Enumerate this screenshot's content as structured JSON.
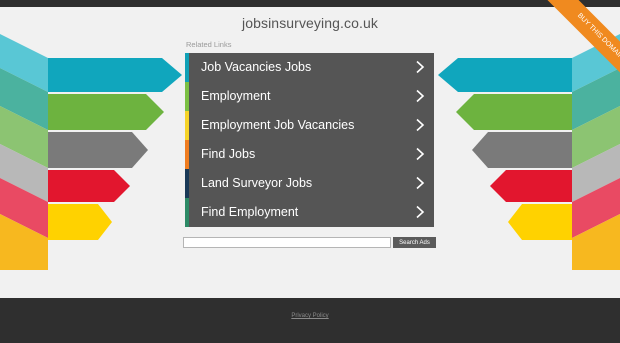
{
  "header": {
    "domain": "jobsinsurveying.co.uk"
  },
  "ribbon": {
    "label": "BUY THIS DOMAIN"
  },
  "related": {
    "label": "Related Links",
    "links": [
      {
        "label": "Job Vacancies Jobs",
        "accent": "#10a0b6"
      },
      {
        "label": "Employment",
        "accent": "#7bc043"
      },
      {
        "label": "Employment Job Vacancies",
        "accent": "#f5d328"
      },
      {
        "label": "Find Jobs",
        "accent": "#f07d20"
      },
      {
        "label": "Land Surveyor Jobs",
        "accent": "#1a3a58"
      },
      {
        "label": "Find Employment",
        "accent": "#2d8a66"
      }
    ],
    "chevron_icon": "chevron-right-icon"
  },
  "search": {
    "input_value": "",
    "button_label": "Search Ads"
  },
  "footer": {
    "privacy_label": "Privacy Policy"
  },
  "colors": {
    "background": "#f1f1f1",
    "dark": "#2f2f2f",
    "link_bg": "#555555",
    "ribbon": "#f08a1f",
    "arrow_cyan": "#10a6bd",
    "arrow_green": "#6db33f",
    "arrow_grey": "#7a7a7a",
    "arrow_red": "#e2162e",
    "arrow_yellow": "#ffd200"
  }
}
